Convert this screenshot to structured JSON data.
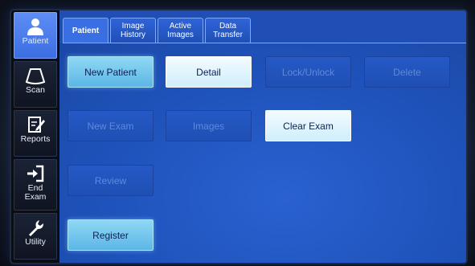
{
  "sidebar": {
    "items": [
      {
        "label": "Patient",
        "icon": "person-icon",
        "active": true
      },
      {
        "label": "Scan",
        "icon": "probe-icon",
        "active": false
      },
      {
        "label": "Reports",
        "icon": "report-edit-icon",
        "active": false
      },
      {
        "label": "End Exam",
        "icon": "exit-icon",
        "active": false
      },
      {
        "label": "Utility",
        "icon": "wrench-icon",
        "active": false
      }
    ]
  },
  "tabs": [
    {
      "label": "Patient",
      "active": true
    },
    {
      "label": "Image History",
      "active": false
    },
    {
      "label": "Active Images",
      "active": false
    },
    {
      "label": "Data Transfer",
      "active": false
    }
  ],
  "buttons": {
    "new_patient": {
      "label": "New Patient",
      "enabled": true
    },
    "detail": {
      "label": "Detail",
      "enabled": true
    },
    "lock_unlock": {
      "label": "Lock/Unlock",
      "enabled": false
    },
    "delete": {
      "label": "Delete",
      "enabled": false
    },
    "new_exam": {
      "label": "New Exam",
      "enabled": false
    },
    "images": {
      "label": "Images",
      "enabled": false
    },
    "clear_exam": {
      "label": "Clear Exam",
      "enabled": true
    },
    "review": {
      "label": "Review",
      "enabled": false
    },
    "register": {
      "label": "Register",
      "enabled": true
    }
  },
  "colors": {
    "screen_bg": "#1f4fb4",
    "button_active": "#8fd8f4",
    "button_disabled": "#2659c6",
    "nav_active": "#5e8df4"
  }
}
